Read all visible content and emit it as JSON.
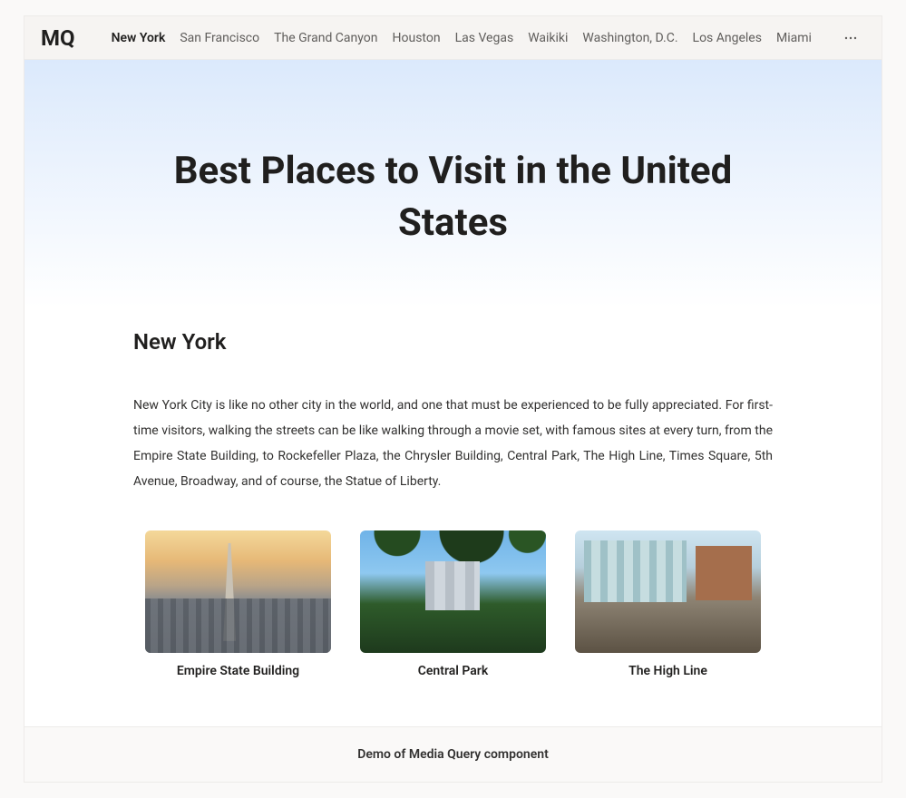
{
  "header": {
    "logo": "MQ",
    "nav_items": [
      "New York",
      "San Francisco",
      "The Grand Canyon",
      "Houston",
      "Las Vegas",
      "Waikiki",
      "Washington, D.C.",
      "Los Angeles",
      "Miami"
    ],
    "active_index": 0
  },
  "hero": {
    "title": "Best Places to Visit in the United States"
  },
  "section": {
    "title": "New York",
    "body": "New York City is like no other city in the world, and one that must be experienced to be fully appreciated. For first-time visitors, walking the streets can be like walking through a movie set, with famous sites at every turn, from the Empire State Building, to Rockefeller Plaza, the Chrysler Building, Central Park, The High Line, Times Square, 5th Avenue, Broadway, and of course, the Statue of Liberty."
  },
  "cards": [
    {
      "caption": "Empire State Building",
      "img_class": "img-esb"
    },
    {
      "caption": "Central Park",
      "img_class": "img-cp"
    },
    {
      "caption": "The High Line",
      "img_class": "img-hl"
    }
  ],
  "footer": {
    "text": "Demo of Media Query component"
  }
}
